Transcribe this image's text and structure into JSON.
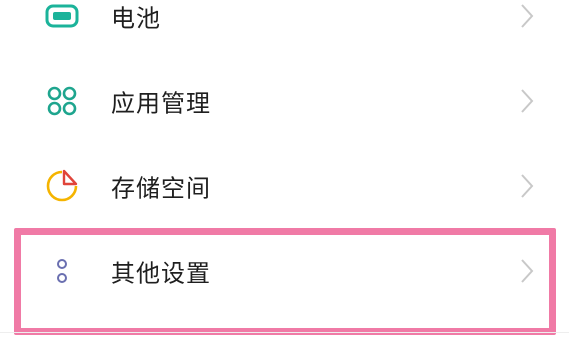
{
  "settings": {
    "items": [
      {
        "label": "电池",
        "icon": "battery-icon"
      },
      {
        "label": "应用管理",
        "icon": "app-management-icon"
      },
      {
        "label": "存储空间",
        "icon": "storage-icon"
      },
      {
        "label": "其他设置",
        "icon": "more-settings-icon"
      }
    ]
  },
  "colors": {
    "battery": "#1bb39a",
    "apps": "#1ea58e",
    "storage_ring": "#f5b400",
    "storage_slice": "#e0443a",
    "more": "#6a6fb0",
    "highlight_border": "#f07aa6",
    "chevron": "#c8c8c8"
  }
}
